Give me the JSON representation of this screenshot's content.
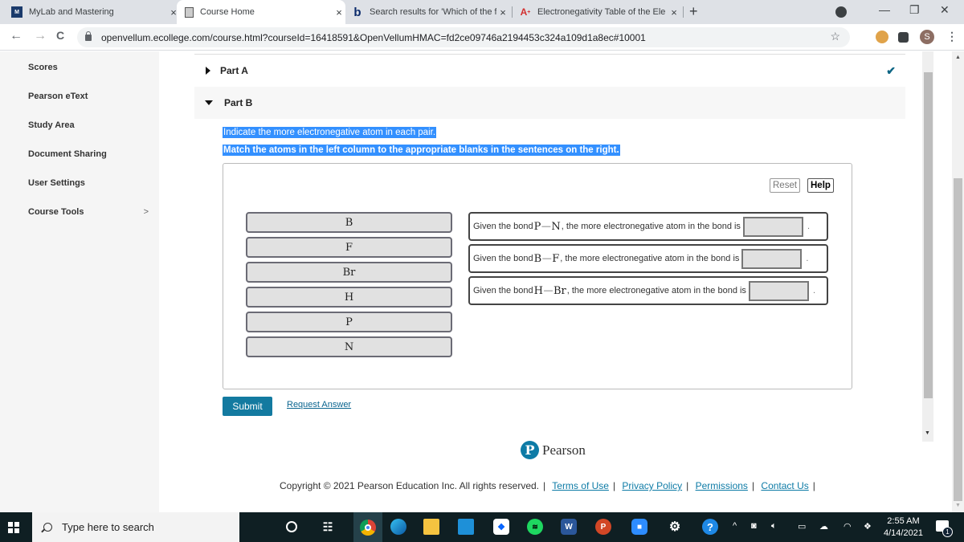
{
  "browser": {
    "tabs": [
      {
        "title": "MyLab and Mastering",
        "icon": "mylab-icon",
        "active": false
      },
      {
        "title": "Course Home",
        "icon": "page-icon",
        "active": true
      },
      {
        "title": "Search results for 'Which of the f",
        "icon": "bing-icon",
        "active": false
      },
      {
        "title": "Electronegativity Table of the Ele",
        "icon": "aplus-icon",
        "active": false
      }
    ],
    "new_tab_label": "+",
    "close_glyph": "×",
    "url": "openvellum.ecollege.com/course.html?courseId=16418591&OpenVellumHMAC=fd2ce09746a2194453c324a109d1a8ec#10001",
    "profile_initial": "S",
    "nav": {
      "back": "←",
      "forward": "→",
      "reload": "C"
    },
    "window_controls": {
      "minimize": "—",
      "maximize": "❐",
      "close": "✕"
    },
    "star": "☆",
    "menu": "⋮"
  },
  "sidebar": {
    "items": [
      {
        "label": "Scores"
      },
      {
        "label": "Pearson eText"
      },
      {
        "label": "Study Area"
      },
      {
        "label": "Document Sharing"
      },
      {
        "label": "User Settings"
      },
      {
        "label": "Course Tools",
        "has_submenu": true,
        "chevron": ">"
      }
    ]
  },
  "question": {
    "part_a": {
      "label": "Part A",
      "completed": true,
      "check": "✔"
    },
    "part_b": {
      "label": "Part B",
      "expanded": true
    },
    "instructions": [
      "Indicate the more electronegative atom in each pair.",
      "Match the atoms in the left column to the appropriate blanks in the sentences on the right."
    ],
    "reset_label": "Reset",
    "help_label": "Help",
    "atoms": [
      "B",
      "F",
      "Br",
      "H",
      "P",
      "N"
    ],
    "sentences": [
      {
        "prefix": "Given the bond ",
        "atom1": "P",
        "dash": "—",
        "atom2": "N",
        "suffix": ", the more electronegative atom in the bond is",
        "answer": "",
        "end": "."
      },
      {
        "prefix": "Given the bond ",
        "atom1": "B",
        "dash": "—",
        "atom2": "F",
        "suffix": ", the more electronegative atom in the bond is",
        "answer": "",
        "end": "."
      },
      {
        "prefix": "Given the bond ",
        "atom1": "H",
        "dash": "—",
        "atom2": "Br",
        "suffix": ", the more electronegative atom in the bond is",
        "answer": "",
        "end": "."
      }
    ],
    "submit_label": "Submit",
    "request_answer_label": "Request Answer"
  },
  "footer": {
    "logo_letter": "P",
    "logo_text": "Pearson",
    "copyright": "Copyright © 2021 Pearson Education Inc. All rights reserved.",
    "links": [
      "Terms of Use",
      "Privacy Policy",
      "Permissions",
      "Contact Us"
    ],
    "separator": "|"
  },
  "taskbar": {
    "search_placeholder": "Type here to search",
    "time": "2:55 AM",
    "date": "4/14/2021",
    "notification_count": "1",
    "apps": [
      "cortana",
      "task-view",
      "chrome",
      "edge",
      "file-explorer",
      "mail",
      "dropbox",
      "spotify",
      "word",
      "powerpoint",
      "zoom",
      "settings",
      "help"
    ],
    "word_letter": "W",
    "ppt_letter": "P"
  },
  "colors": {
    "accent": "#137aa0",
    "selection": "#3390ff",
    "link": "#0d7ba6"
  }
}
